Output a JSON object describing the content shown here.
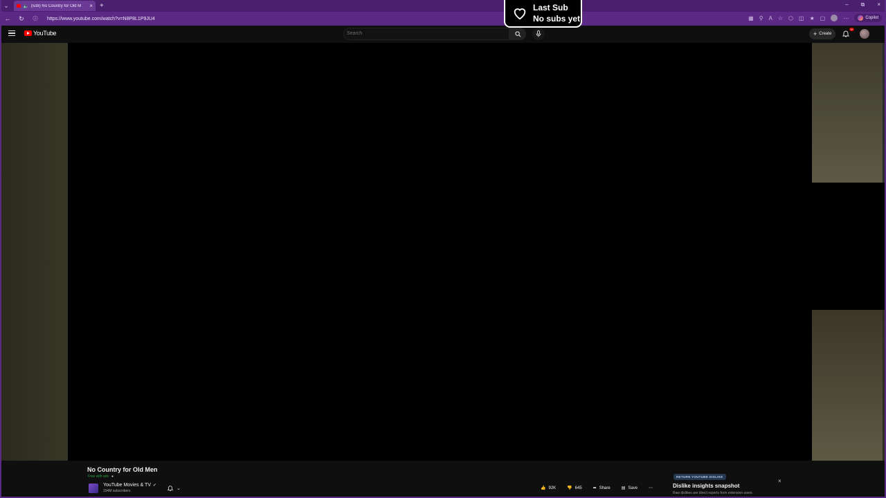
{
  "browser": {
    "tab_title": "(538) No Country for Old M",
    "url": "https://www.youtube.com/watch?v=N8P8L1P9JU4",
    "copilot_label": "Copilot"
  },
  "overlay": {
    "line1": "Last Sub",
    "line2": "No subs yet"
  },
  "youtube": {
    "logo_text": "YouTube",
    "search_placeholder": "Search",
    "create_label": "Create",
    "notification_badge": "9+"
  },
  "video": {
    "title": "No Country for Old Men",
    "free_label": "Free with ads",
    "channel_name": "YouTube Movies & TV",
    "subscribers": "194M subscribers",
    "likes": "92K",
    "dislikes": "645",
    "share_label": "Share",
    "save_label": "Save"
  },
  "ryd": {
    "badge": "RETURN YOUTUBE DISLIKE",
    "title": "Dislike insights snapshot",
    "subtitle": "Raw dislikes are direct reports from extension users"
  },
  "colors": {
    "chrome_purple": "#5c2a85",
    "yt_red": "#ff0000",
    "free_green": "#2ba640"
  }
}
